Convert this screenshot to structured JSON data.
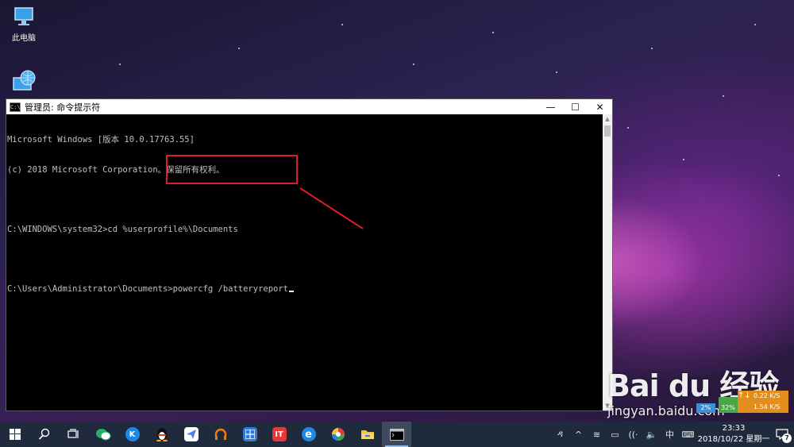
{
  "desktop": {
    "icons": [
      {
        "label": "此电脑",
        "icon": "computer-icon"
      },
      {
        "label": "",
        "icon": "network-globe-icon"
      }
    ]
  },
  "window": {
    "title": "管理员: 命令提示符",
    "app_icon_text": "C:\\",
    "controls": {
      "minimize": "—",
      "maximize": "☐",
      "close": "✕"
    }
  },
  "console": {
    "lines": [
      "Microsoft Windows [版本 10.0.17763.55]",
      "(c) 2018 Microsoft Corporation。保留所有权利。",
      "",
      "C:\\WINDOWS\\system32>cd %userprofile%\\Documents",
      "",
      "C:\\Users\\Administrator\\Documents>powercfg /batteryreport"
    ]
  },
  "annotation": {
    "color": "#e01b2b"
  },
  "watermark": {
    "brand": "Bai du 经验",
    "url": "jingyan.baidu.com"
  },
  "net_widget": {
    "cpu": "2%",
    "mem": "32%",
    "arrows": "↑↓",
    "upload": "0.22 K/S",
    "download": "1.54 K/S"
  },
  "taskbar": {
    "apps": [
      {
        "name": "start",
        "icon": "windows-start-icon"
      },
      {
        "name": "search",
        "icon": "search-icon"
      },
      {
        "name": "task-view",
        "icon": "task-view-icon"
      },
      {
        "name": "wechat",
        "icon": "wechat-icon",
        "color": "#2aae67"
      },
      {
        "name": "kugou",
        "icon": "kugou-icon",
        "color": "#1e88e5",
        "text": "K"
      },
      {
        "name": "qq",
        "icon": "qq-penguin-icon"
      },
      {
        "name": "feishu",
        "icon": "paper-plane-icon",
        "color": "#4a7df0"
      },
      {
        "name": "headphones",
        "icon": "headphones-icon",
        "color": "#f57c00"
      },
      {
        "name": "windows-app",
        "icon": "window-app-icon",
        "color": "#2f7ad8"
      },
      {
        "name": "it-app",
        "icon": "it-app-icon",
        "color": "#e53935",
        "text": "IT"
      },
      {
        "name": "edge",
        "icon": "ie-edge-icon",
        "color": "#1e88e5",
        "text": "e"
      },
      {
        "name": "colorful-app",
        "icon": "color-wheel-icon"
      },
      {
        "name": "file-explorer",
        "icon": "folder-icon",
        "color": "#f2c14e"
      },
      {
        "name": "cmd",
        "icon": "cmd-icon",
        "active": true
      }
    ],
    "tray": {
      "people": "ዳ",
      "chevron": "^",
      "ime_extra": "≋",
      "battery": "▭",
      "wifi": "((·",
      "volume": "🔈",
      "lang": "中",
      "keyboard": "⌨",
      "time": "23:33",
      "date": "2018/10/22 星期一",
      "notifications": "7"
    }
  }
}
